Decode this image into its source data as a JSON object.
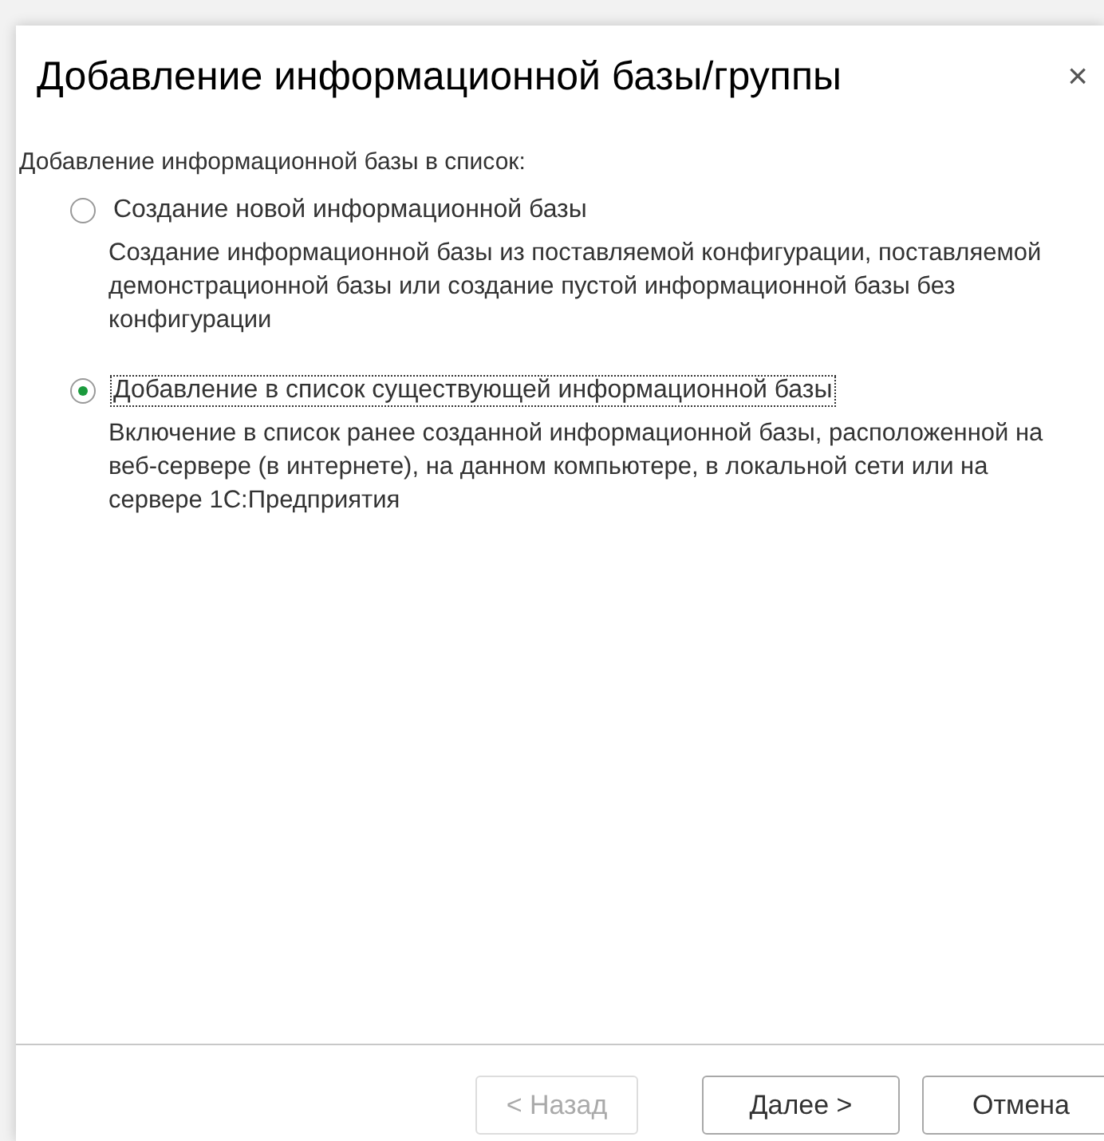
{
  "window": {
    "title": "Добавление информационной базы/группы",
    "close": "×"
  },
  "prompt": "Добавление информационной базы в список:",
  "options": [
    {
      "label": "Создание новой информационной базы",
      "description": "Создание информационной базы из поставляемой конфигурации, поставляемой демонстрационной базы или создание пустой информационной базы без конфигурации",
      "selected": false
    },
    {
      "label": "Добавление в список существующей информационной базы",
      "description": "Включение в список ранее созданной информационной базы, расположенной на веб-сервере (в интернете), на данном компьютере,  в локальной сети или на сервере 1С:Предприятия",
      "selected": true
    }
  ],
  "buttons": [
    {
      "label": "< Назад",
      "disabled": true
    },
    {
      "label": "Далее >",
      "disabled": false
    },
    {
      "label": "Отмена",
      "disabled": false
    }
  ]
}
